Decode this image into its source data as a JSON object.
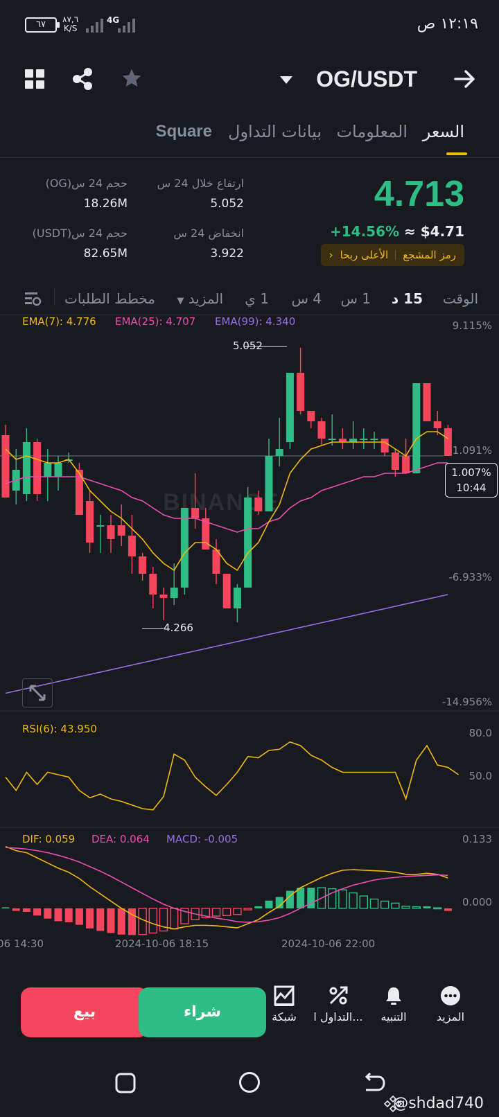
{
  "status_bar": {
    "time": "١٢:١٩ ص",
    "battery": "٦٧",
    "net_speed_value": "٨٧,٦",
    "net_speed_unit": "K/S",
    "network": "4G"
  },
  "header": {
    "pair": "OG/USDT",
    "icons": [
      "back-arrow-icon",
      "dropdown-caret-icon",
      "star-icon",
      "share-icon",
      "grid-icon"
    ]
  },
  "tabs": [
    {
      "label": "السعر",
      "active": true
    },
    {
      "label": "المعلومات",
      "active": false
    },
    {
      "label": "بيانات التداول",
      "active": false
    },
    {
      "label": "Square",
      "active": false
    }
  ],
  "price": {
    "last": "4.713",
    "approx": "≈ $4.71",
    "change": "+14.56%",
    "tag_primary": "رمز المشجع",
    "tag_secondary": "الأعلى ربحا"
  },
  "stats": {
    "high_label": "ارتفاع خلال 24 س",
    "high_value": "5.052",
    "low_label": "انخفاض 24 س",
    "low_value": "3.922",
    "vol_base_label": "حجم 24 س(OG)",
    "vol_base_value": "18.26M",
    "vol_quote_label": "حجم 24 س(USDT)",
    "vol_quote_value": "82.65M"
  },
  "intervals": {
    "time_label": "الوقت",
    "items": [
      "15 د",
      "1 س",
      "4 س",
      "1 ي"
    ],
    "active_index": 0,
    "more": "المزيد",
    "depth": "مخطط الطلبات"
  },
  "indicators": {
    "ema7": "EMA(7): 4.776",
    "ema25": "EMA(25): 4.707",
    "ema99": "EMA(99): 4.340",
    "rsi": "RSI(6): 43.950",
    "dif": "DIF: 0.059",
    "dea": "DEA: 0.064",
    "macd": "MACD: -0.005"
  },
  "chart_labels": {
    "pct_top": "9.115%",
    "pct_mid_hidden": "1.091%",
    "pct_low": "-6.933%",
    "pct_bottom": "-14.956%",
    "current_pct": "1.007%",
    "countdown": "10:44",
    "high_mark": "5.052",
    "low_mark": "4.266",
    "rsi_80": "80.0",
    "rsi_50": "50.0",
    "macd_top": "0.133",
    "macd_zero": "0.000",
    "watermark": "BINANCE",
    "x_ticks": [
      "06 14:30",
      "2024-10-06 18:15",
      "2024-10-06 22:00"
    ]
  },
  "colors": {
    "up": "#2ebd85",
    "down": "#f6465d",
    "ema7": "#f0b90b",
    "ema25": "#e84fb5",
    "ema99": "#9a6ee6",
    "accent": "#f0b90b"
  },
  "chart_data": {
    "type": "candlestick",
    "candles": [
      {
        "o": 4.8,
        "h": 4.83,
        "l": 4.62,
        "c": 4.62
      },
      {
        "o": 4.64,
        "h": 4.76,
        "l": 4.6,
        "c": 4.7
      },
      {
        "o": 4.63,
        "h": 4.82,
        "l": 4.61,
        "c": 4.78
      },
      {
        "o": 4.78,
        "h": 4.79,
        "l": 4.61,
        "c": 4.63
      },
      {
        "o": 4.68,
        "h": 4.76,
        "l": 4.61,
        "c": 4.72
      },
      {
        "o": 4.68,
        "h": 4.74,
        "l": 4.64,
        "c": 4.72
      },
      {
        "o": 4.73,
        "h": 4.75,
        "l": 4.72,
        "c": 4.73
      },
      {
        "o": 4.7,
        "h": 4.72,
        "l": 4.57,
        "c": 4.57
      },
      {
        "o": 4.61,
        "h": 4.64,
        "l": 4.46,
        "c": 4.49
      },
      {
        "o": 4.54,
        "h": 4.57,
        "l": 4.46,
        "c": 4.54
      },
      {
        "o": 4.54,
        "h": 4.57,
        "l": 4.46,
        "c": 4.5
      },
      {
        "o": 4.54,
        "h": 4.6,
        "l": 4.48,
        "c": 4.51
      },
      {
        "o": 4.51,
        "h": 4.57,
        "l": 4.4,
        "c": 4.45
      },
      {
        "o": 4.45,
        "h": 4.46,
        "l": 4.38,
        "c": 4.4
      },
      {
        "o": 4.4,
        "h": 4.42,
        "l": 4.3,
        "c": 4.34
      },
      {
        "o": 4.34,
        "h": 4.36,
        "l": 4.266,
        "c": 4.33
      },
      {
        "o": 4.33,
        "h": 4.43,
        "l": 4.31,
        "c": 4.36
      },
      {
        "o": 4.36,
        "h": 4.59,
        "l": 4.34,
        "c": 4.59
      },
      {
        "o": 4.59,
        "h": 4.69,
        "l": 4.53,
        "c": 4.56
      },
      {
        "o": 4.56,
        "h": 4.59,
        "l": 4.47,
        "c": 4.47
      },
      {
        "o": 4.47,
        "h": 4.5,
        "l": 4.37,
        "c": 4.4
      },
      {
        "o": 4.4,
        "h": 4.4,
        "l": 4.3,
        "c": 4.3
      },
      {
        "o": 4.3,
        "h": 4.37,
        "l": 4.26,
        "c": 4.36
      },
      {
        "o": 4.36,
        "h": 4.65,
        "l": 4.36,
        "c": 4.62
      },
      {
        "o": 4.62,
        "h": 4.64,
        "l": 4.57,
        "c": 4.58
      },
      {
        "o": 4.58,
        "h": 4.79,
        "l": 4.58,
        "c": 4.74
      },
      {
        "o": 4.74,
        "h": 4.85,
        "l": 4.71,
        "c": 4.76
      },
      {
        "o": 4.78,
        "h": 4.98,
        "l": 4.76,
        "c": 4.98
      },
      {
        "o": 4.98,
        "h": 5.052,
        "l": 4.86,
        "c": 4.87
      },
      {
        "o": 4.87,
        "h": 4.87,
        "l": 4.82,
        "c": 4.84
      },
      {
        "o": 4.84,
        "h": 4.85,
        "l": 4.77,
        "c": 4.79
      },
      {
        "o": 4.79,
        "h": 4.86,
        "l": 4.77,
        "c": 4.79
      },
      {
        "o": 4.79,
        "h": 4.82,
        "l": 4.76,
        "c": 4.78
      },
      {
        "o": 4.78,
        "h": 4.84,
        "l": 4.76,
        "c": 4.79
      },
      {
        "o": 4.79,
        "h": 4.82,
        "l": 4.76,
        "c": 4.79
      },
      {
        "o": 4.79,
        "h": 4.81,
        "l": 4.76,
        "c": 4.79
      },
      {
        "o": 4.79,
        "h": 4.79,
        "l": 4.74,
        "c": 4.75
      },
      {
        "o": 4.75,
        "h": 4.76,
        "l": 4.68,
        "c": 4.7
      },
      {
        "o": 4.74,
        "h": 4.79,
        "l": 4.69,
        "c": 4.69
      },
      {
        "o": 4.69,
        "h": 4.95,
        "l": 4.69,
        "c": 4.95
      },
      {
        "o": 4.95,
        "h": 4.95,
        "l": 4.84,
        "c": 4.84
      },
      {
        "o": 4.84,
        "h": 4.87,
        "l": 4.8,
        "c": 4.82
      },
      {
        "o": 4.82,
        "h": 4.83,
        "l": 4.74,
        "c": 4.74
      }
    ],
    "ema7": [
      4.76,
      4.73,
      4.74,
      4.73,
      4.72,
      4.72,
      4.73,
      4.69,
      4.64,
      4.61,
      4.58,
      4.56,
      4.53,
      4.5,
      4.46,
      4.43,
      4.41,
      4.46,
      4.49,
      4.49,
      4.47,
      4.43,
      4.41,
      4.46,
      4.49,
      4.55,
      4.6,
      4.69,
      4.73,
      4.76,
      4.77,
      4.78,
      4.78,
      4.78,
      4.78,
      4.78,
      4.78,
      4.76,
      4.74,
      4.79,
      4.81,
      4.81,
      4.79
    ],
    "ema25": [
      4.66,
      4.67,
      4.68,
      4.68,
      4.68,
      4.68,
      4.68,
      4.68,
      4.67,
      4.66,
      4.65,
      4.64,
      4.62,
      4.61,
      4.59,
      4.57,
      4.56,
      4.56,
      4.56,
      4.55,
      4.54,
      4.53,
      4.52,
      4.53,
      4.53,
      4.55,
      4.56,
      4.59,
      4.61,
      4.62,
      4.64,
      4.65,
      4.66,
      4.67,
      4.68,
      4.68,
      4.69,
      4.69,
      4.69,
      4.7,
      4.71,
      4.72,
      4.72
    ],
    "ema99_pts": [
      [
        0,
        4.055
      ],
      [
        42,
        4.34
      ]
    ],
    "rsi": [
      58,
      47,
      62,
      52,
      62,
      60,
      58,
      47,
      41,
      44,
      40,
      38,
      35,
      32,
      31,
      42,
      77,
      72,
      58,
      50,
      43,
      52,
      62,
      75,
      74,
      80,
      81,
      87,
      84,
      76,
      72,
      66,
      62,
      62,
      62,
      62,
      62,
      62,
      40,
      72,
      84,
      68,
      66,
      60
    ],
    "rsi_range": [
      20,
      100
    ],
    "dif": [
      0.12,
      0.112,
      0.108,
      0.098,
      0.088,
      0.078,
      0.07,
      0.058,
      0.042,
      0.028,
      0.014,
      0.0,
      -0.012,
      -0.022,
      -0.03,
      -0.036,
      -0.04,
      -0.036,
      -0.033,
      -0.033,
      -0.034,
      -0.036,
      -0.038,
      -0.03,
      -0.022,
      -0.008,
      0.004,
      0.024,
      0.04,
      0.05,
      0.06,
      0.068,
      0.074,
      0.075,
      0.074,
      0.073,
      0.072,
      0.07,
      0.066,
      0.066,
      0.068,
      0.066,
      0.059
    ],
    "dea": [
      0.118,
      0.117,
      0.115,
      0.112,
      0.108,
      0.103,
      0.097,
      0.09,
      0.081,
      0.072,
      0.062,
      0.051,
      0.04,
      0.029,
      0.018,
      0.008,
      0.0,
      -0.006,
      -0.011,
      -0.015,
      -0.019,
      -0.022,
      -0.026,
      -0.027,
      -0.026,
      -0.023,
      -0.018,
      -0.01,
      0.0,
      0.01,
      0.02,
      0.03,
      0.038,
      0.045,
      0.05,
      0.055,
      0.058,
      0.06,
      0.062,
      0.063,
      0.064,
      0.065,
      0.064
    ],
    "macd_range": [
      -0.05,
      0.133
    ],
    "x_ticks": [
      "06 14:30",
      "2024-10-06 18:15",
      "2024-10-06 22:00"
    ]
  },
  "actions": {
    "sell": "بيع",
    "buy": "شراء",
    "grid": "شبكة",
    "trade": "التداول ا...",
    "alert": "التنبيه",
    "more": "المزيد"
  },
  "footer": {
    "handle": "@shdad740"
  }
}
